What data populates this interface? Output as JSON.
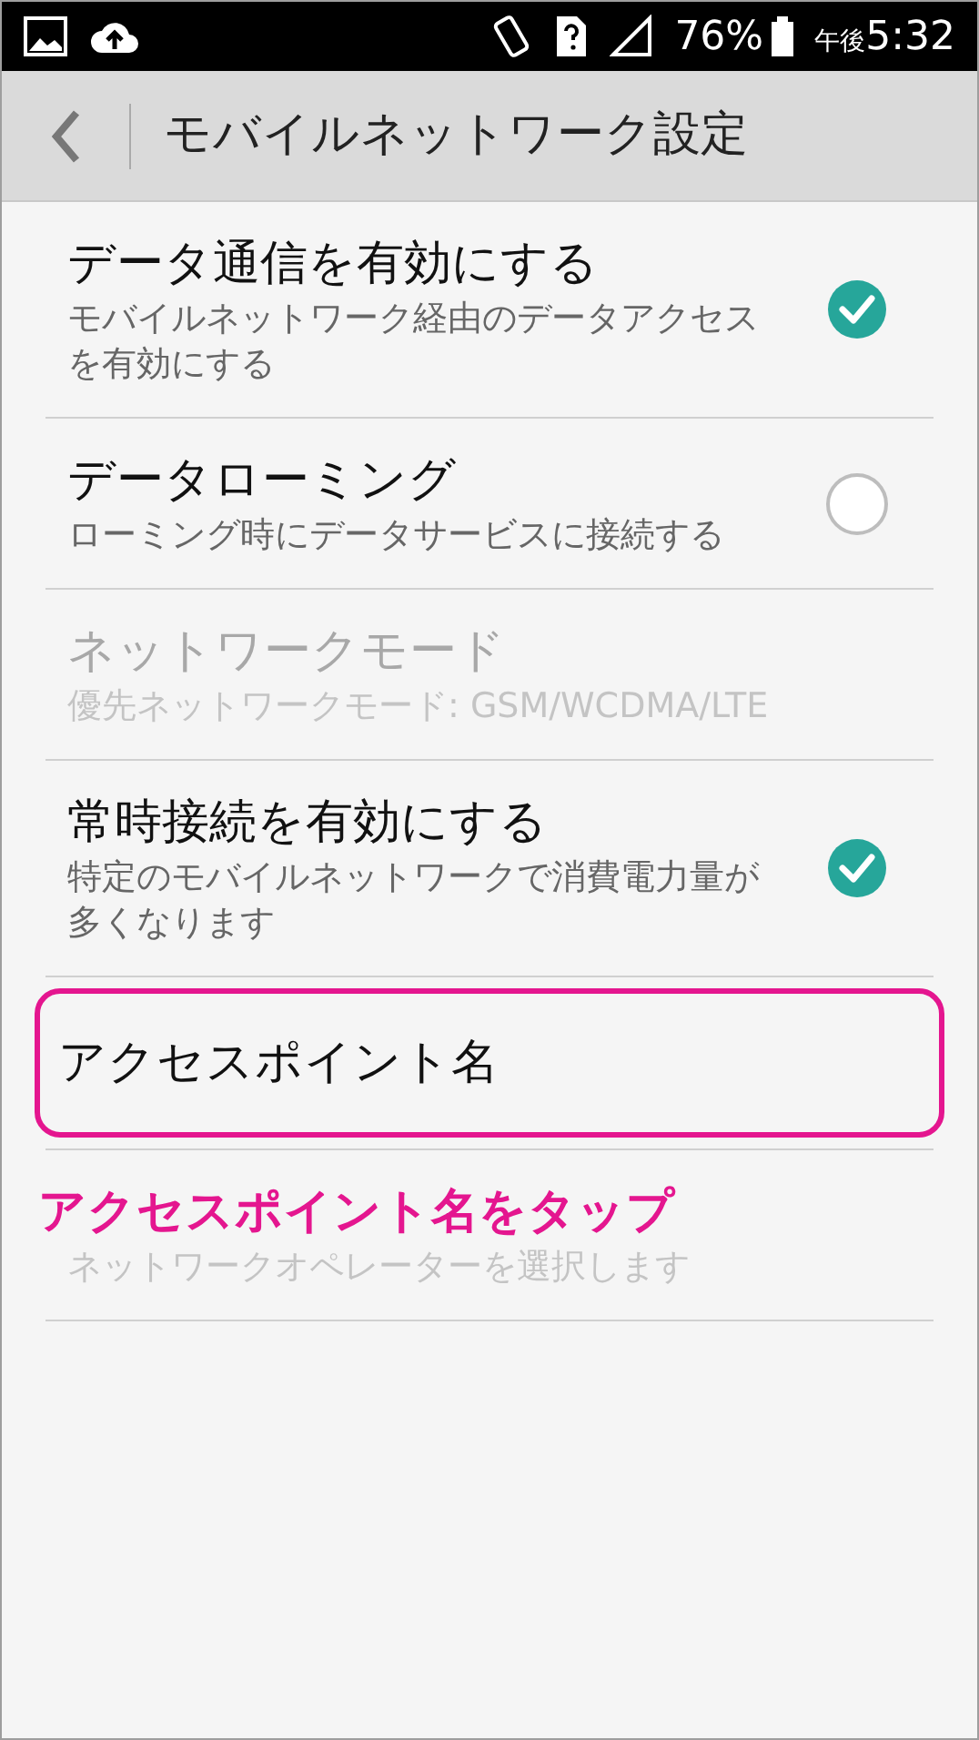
{
  "status_bar": {
    "battery": "76%",
    "time_prefix": "午後",
    "time": "5:32"
  },
  "header": {
    "title": "モバイルネットワーク設定"
  },
  "items": [
    {
      "kind": "toggle",
      "title": "データ通信を有効にする",
      "subtitle": "モバイルネットワーク経由のデータアクセスを有効にする",
      "checked": true,
      "disabled": false,
      "highlighted": false
    },
    {
      "kind": "toggle",
      "title": "データローミング",
      "subtitle": "ローミング時にデータサービスに接続する",
      "checked": false,
      "disabled": false,
      "highlighted": false
    },
    {
      "kind": "plain",
      "title": "ネットワークモード",
      "subtitle": "優先ネットワークモード: GSM/WCDMA/LTE",
      "disabled": true,
      "highlighted": false
    },
    {
      "kind": "toggle",
      "title": "常時接続を有効にする",
      "subtitle": "特定のモバイルネットワークで消費電力量が多くなります",
      "checked": true,
      "disabled": false,
      "highlighted": false
    },
    {
      "kind": "plain",
      "title": "アクセスポイント名",
      "disabled": false,
      "highlighted": true
    },
    {
      "kind": "plain",
      "subtitle": "ネットワークオペレーターを選択します",
      "disabled": true,
      "highlighted": false
    }
  ],
  "annotation": "アクセスポイント名をタップ"
}
